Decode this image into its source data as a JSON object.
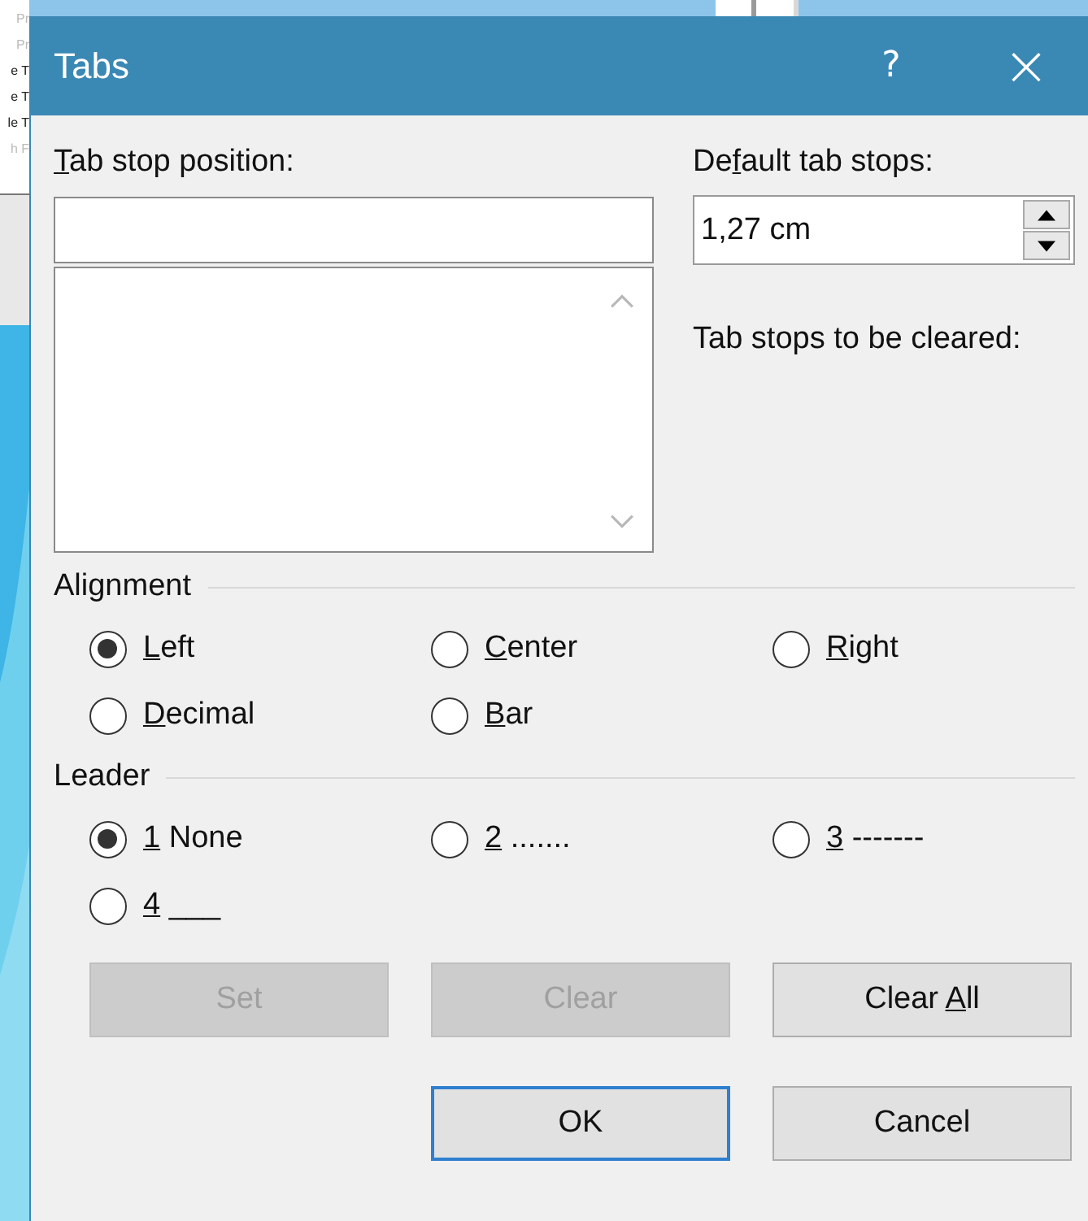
{
  "background_fragments": [
    {
      "text": "Pr",
      "faint": true
    },
    {
      "text": "Pr",
      "faint": true
    },
    {
      "text": "e T",
      "faint": false
    },
    {
      "text": "e T",
      "faint": false
    },
    {
      "text": "le T",
      "faint": false
    },
    {
      "text": "h F",
      "faint": true
    }
  ],
  "window": {
    "title": "Tabs",
    "help": "?",
    "close": "×"
  },
  "tab_stop_position": {
    "label": {
      "key": "T",
      "after": "ab stop position:"
    }
  },
  "default_tab_stops": {
    "label": {
      "before": "De",
      "key": "f",
      "after": "ault tab stops:"
    },
    "value": "1,27 cm"
  },
  "cleared_label": "Tab stops to be cleared:",
  "alignment": {
    "title": "Alignment",
    "options": [
      {
        "key": "L",
        "after": "eft",
        "selected": true
      },
      {
        "key": "C",
        "after": "enter",
        "selected": false
      },
      {
        "key": "R",
        "after": "ight",
        "selected": false
      },
      {
        "key": "D",
        "after": "ecimal",
        "selected": false
      },
      {
        "key": "B",
        "after": "ar",
        "selected": false
      }
    ]
  },
  "leader": {
    "title": "Leader",
    "options": [
      {
        "key": "1",
        "after": " None",
        "selected": true
      },
      {
        "key": "2",
        "after": " .......",
        "selected": false
      },
      {
        "key": "3",
        "after": " -------",
        "selected": false
      },
      {
        "key": "4",
        "after": " ___",
        "selected": false
      }
    ]
  },
  "action_buttons": [
    {
      "before": "Set",
      "disabled": true
    },
    {
      "before": "Clear",
      "disabled": true
    },
    {
      "before": "Clear ",
      "key": "A",
      "after": "ll",
      "disabled": false
    }
  ],
  "footer_buttons": [
    {
      "label": "OK",
      "default": true
    },
    {
      "label": "Cancel",
      "default": false
    }
  ]
}
